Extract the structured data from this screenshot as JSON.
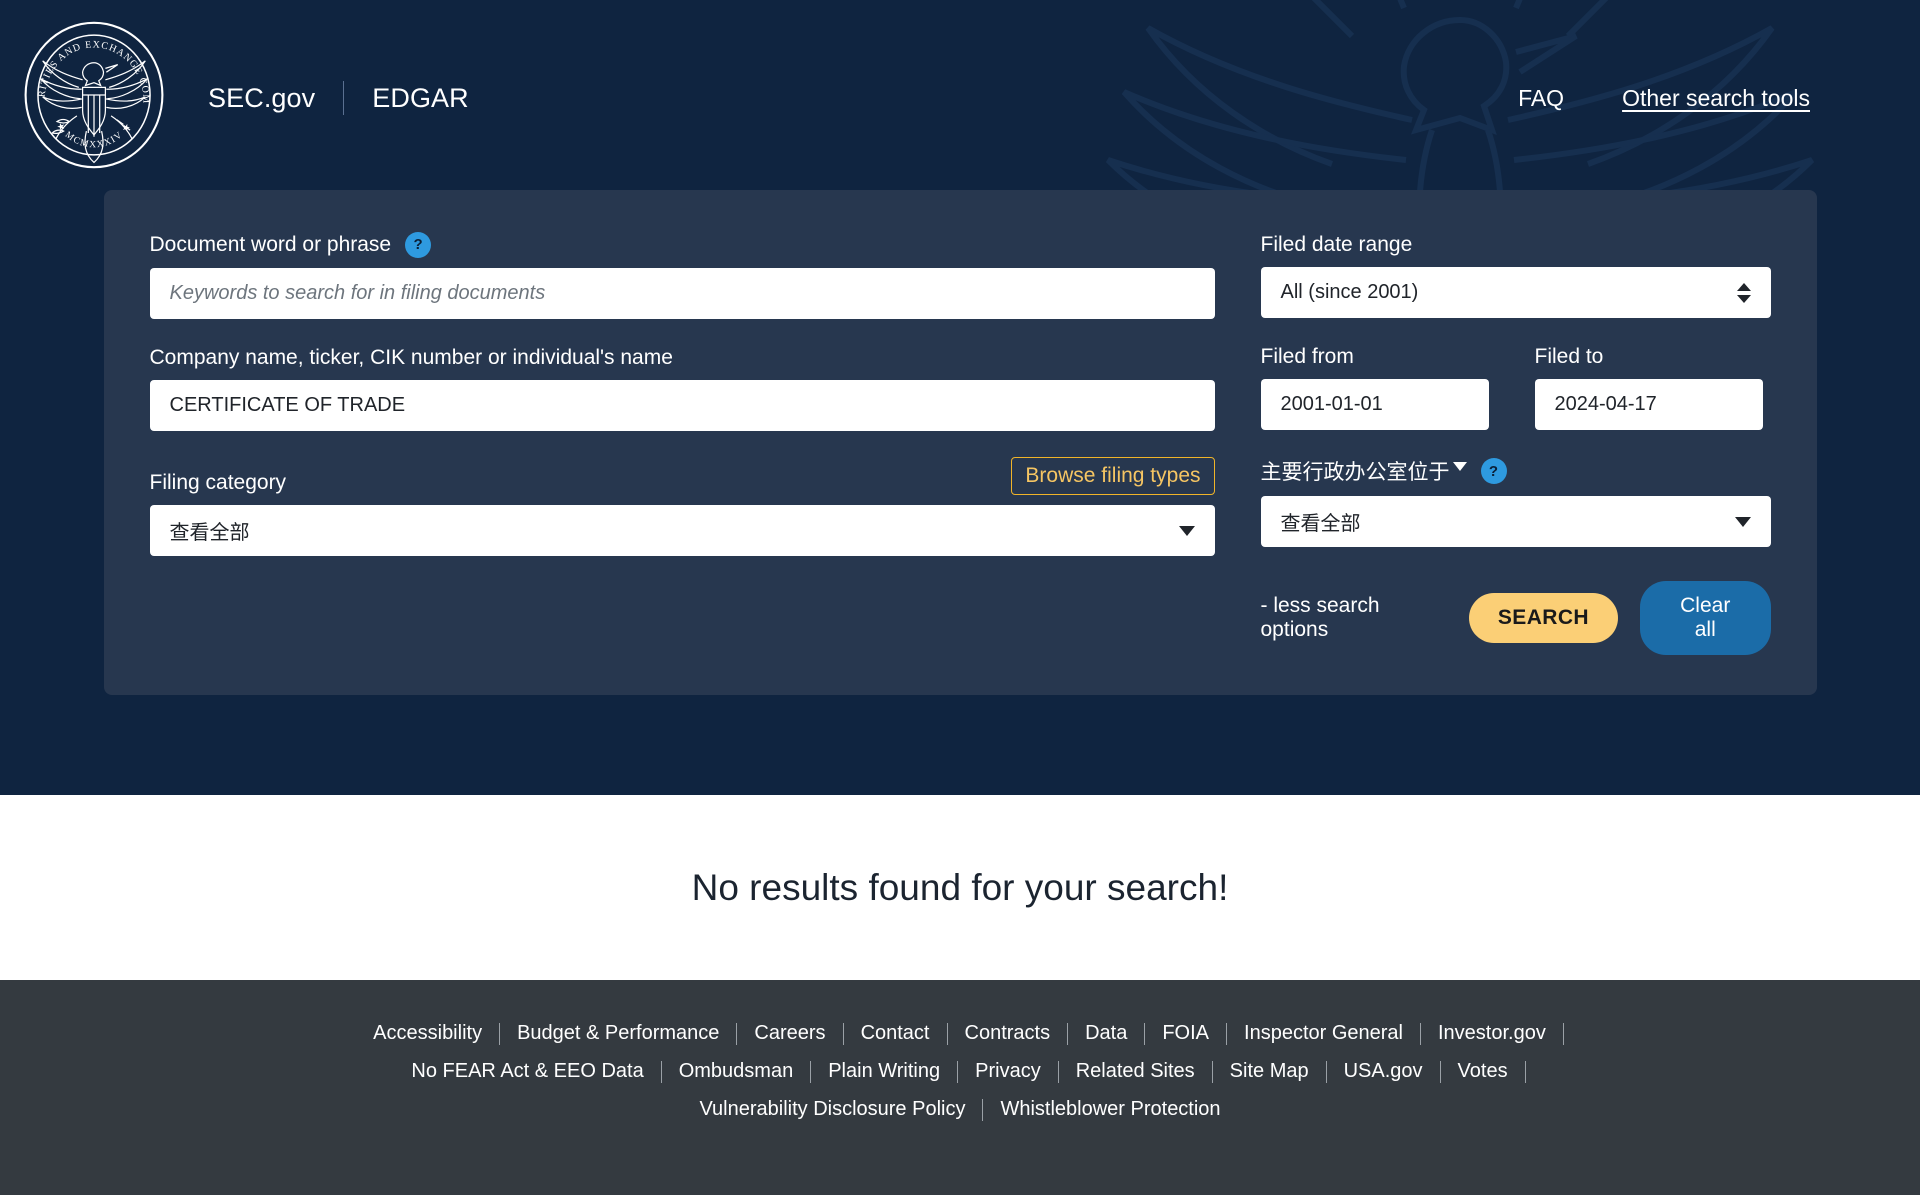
{
  "header": {
    "logo_alt": "U.S. Securities and Exchange Commission seal",
    "site_name": "SEC.gov",
    "app_name": "EDGAR",
    "faq_label": "FAQ",
    "other_tools_label": "Other search tools"
  },
  "search": {
    "document_label": "Document word or phrase",
    "document_help": "?",
    "document_placeholder": "Keywords to search for in filing documents",
    "document_value": "",
    "company_label": "Company name, ticker, CIK number or individual's name",
    "company_value": "CERTIFICATE OF TRADE",
    "filing_category_label": "Filing category",
    "browse_filing_types_label": "Browse filing types",
    "filing_category_value": "查看全部",
    "filed_date_range_label": "Filed date range",
    "filed_date_range_value": "All (since 2001)",
    "filed_from_label": "Filed from",
    "filed_from_value": "2001-01-01",
    "filed_to_label": "Filed to",
    "filed_to_value": "2024-04-17",
    "location_label": "主要行政办公室位于",
    "location_help": "?",
    "location_value": "查看全部",
    "less_options_label": "- less search options",
    "search_button_label": "SEARCH",
    "clear_button_label": "Clear all"
  },
  "results": {
    "message": "No results found for your search!"
  },
  "footer": {
    "row1": [
      "Accessibility",
      "Budget & Performance",
      "Careers",
      "Contact",
      "Contracts",
      "Data",
      "FOIA",
      "Inspector General",
      "Investor.gov"
    ],
    "row2": [
      "No FEAR Act & EEO Data",
      "Ombudsman",
      "Plain Writing",
      "Privacy",
      "Related Sites",
      "Site Map",
      "USA.gov",
      "Votes"
    ],
    "row3": [
      "Vulnerability Disclosure Policy",
      "Whistleblower Protection"
    ]
  },
  "colors": {
    "hero_background": "#0f2440",
    "panel_background": "#27374f",
    "accent_gold": "#fbcf76",
    "accent_blue": "#1b6ca8",
    "help_icon_blue": "#2e9ae0",
    "browse_border": "#f0b429",
    "footer_background": "#343a40"
  }
}
